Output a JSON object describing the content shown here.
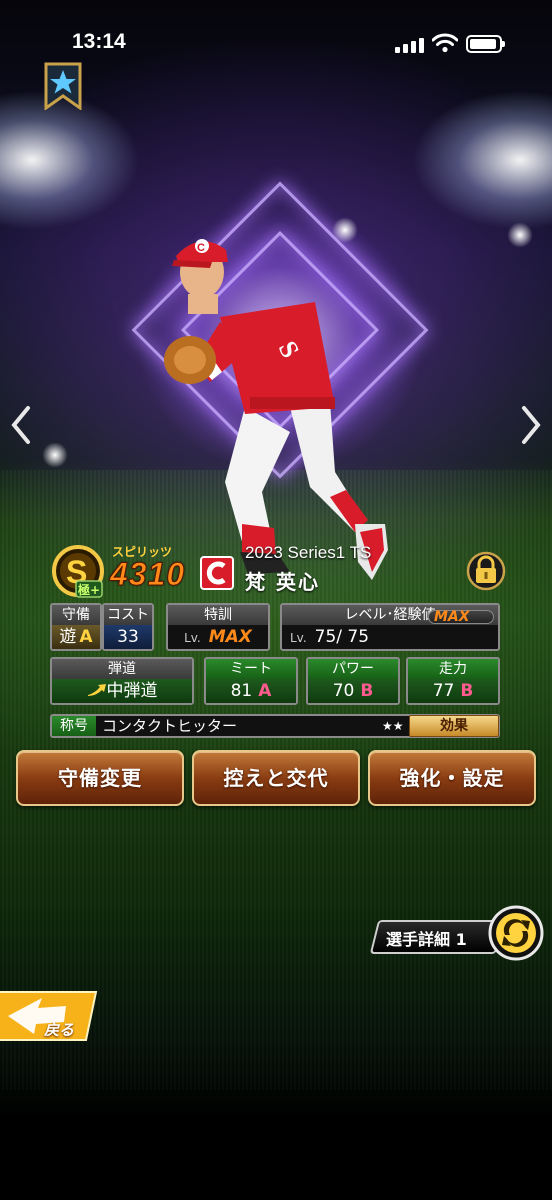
{
  "status_bar": {
    "time": "13:14"
  },
  "card": {
    "spirits_label": "スピリッツ",
    "spirits_value": "4310",
    "rank_badge_icon": "s-rank-badge-icon",
    "rank_sub_label": "極+",
    "series": "2023 Series1 TS",
    "player_name": "梵 英心",
    "team_logo": "C"
  },
  "stats": {
    "defense": {
      "header": "守備",
      "position": "遊",
      "grade": "A"
    },
    "cost": {
      "header": "コスト",
      "value": "33"
    },
    "training": {
      "header": "特訓",
      "lv_label": "Lv.",
      "value": "MAX"
    },
    "level": {
      "header": "レベル･経験値",
      "lv_label": "Lv.",
      "value": "75/ 75",
      "exp_label": "MAX"
    },
    "trajectory": {
      "header": "弾道",
      "value": "中弾道"
    },
    "meet": {
      "header": "ミート",
      "value": "81",
      "grade": "A"
    },
    "power": {
      "header": "パワー",
      "value": "70",
      "grade": "B"
    },
    "speed": {
      "header": "走力",
      "value": "77",
      "grade": "B"
    }
  },
  "title_row": {
    "label": "称号",
    "value": "コンタクトヒッター",
    "stars": "★★",
    "effect_button": "効果"
  },
  "actions": {
    "defense_change": "守備変更",
    "bench_swap": "控えと交代",
    "enhance_settings": "強化・設定"
  },
  "detail": {
    "label": "選手詳細 1"
  },
  "back": {
    "label": "戻る"
  },
  "colors": {
    "accent_orange": "#ff8a1a",
    "grade_pink": "#ff5b8f",
    "button_brown": "#8a3d12"
  }
}
